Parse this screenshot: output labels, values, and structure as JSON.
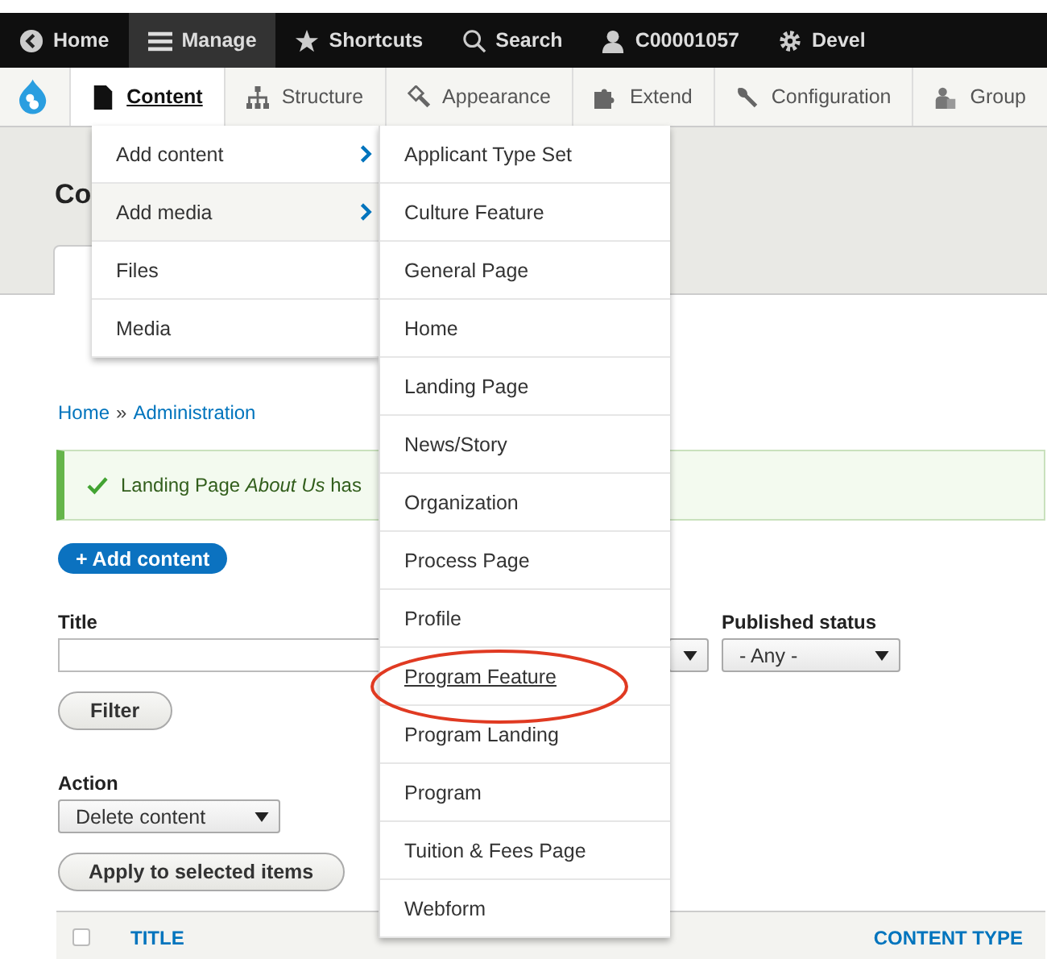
{
  "toolbar": {
    "items": [
      {
        "label": "Home",
        "selected": false
      },
      {
        "label": "Manage",
        "selected": true
      },
      {
        "label": "Shortcuts",
        "selected": false
      },
      {
        "label": "Search",
        "selected": false
      },
      {
        "label": "C00001057",
        "selected": false
      },
      {
        "label": "Devel",
        "selected": false
      }
    ]
  },
  "tray": {
    "items": [
      {
        "label": "Content",
        "selected": true
      },
      {
        "label": "Structure",
        "selected": false
      },
      {
        "label": "Appearance",
        "selected": false
      },
      {
        "label": "Extend",
        "selected": false
      },
      {
        "label": "Configuration",
        "selected": false
      },
      {
        "label": "Group",
        "selected": false
      }
    ]
  },
  "page_title": "Co",
  "breadcrumb": [
    "Home",
    "Administration"
  ],
  "breadcrumb_separator": "»",
  "message": "Landing Page *About Us* has",
  "add_button": "+ Add content",
  "filters": {
    "title_label": "Title",
    "status_label": "Published status",
    "status_value": "- Any -",
    "filter_button": "Filter"
  },
  "action": {
    "label": "Action",
    "value": "Delete content",
    "apply_button": "Apply to selected items"
  },
  "table": {
    "select_all_checked": false,
    "columns": [
      "TITLE",
      "CONTENT TYPE"
    ]
  },
  "menu": {
    "items": [
      {
        "label": "Add content",
        "has_submenu": true,
        "selected": false
      },
      {
        "label": "Add media",
        "has_submenu": true,
        "selected": true
      },
      {
        "label": "Files",
        "has_submenu": false,
        "selected": false
      },
      {
        "label": "Media",
        "has_submenu": false,
        "selected": false
      }
    ]
  },
  "submenu": {
    "items": [
      {
        "label": "Applicant Type Set",
        "selected": false
      },
      {
        "label": "Culture Feature",
        "selected": false
      },
      {
        "label": "General Page",
        "selected": false
      },
      {
        "label": "Home",
        "selected": false
      },
      {
        "label": "Landing Page",
        "selected": false
      },
      {
        "label": "News/Story",
        "selected": false
      },
      {
        "label": "Organization",
        "selected": false
      },
      {
        "label": "Process Page",
        "selected": false
      },
      {
        "label": "Profile",
        "selected": false
      },
      {
        "label": "Program Feature",
        "selected": true
      },
      {
        "label": "Program Landing",
        "selected": false
      },
      {
        "label": "Program",
        "selected": false
      },
      {
        "label": "Tuition & Fees Page",
        "selected": false
      },
      {
        "label": "Webform",
        "selected": false
      }
    ]
  }
}
